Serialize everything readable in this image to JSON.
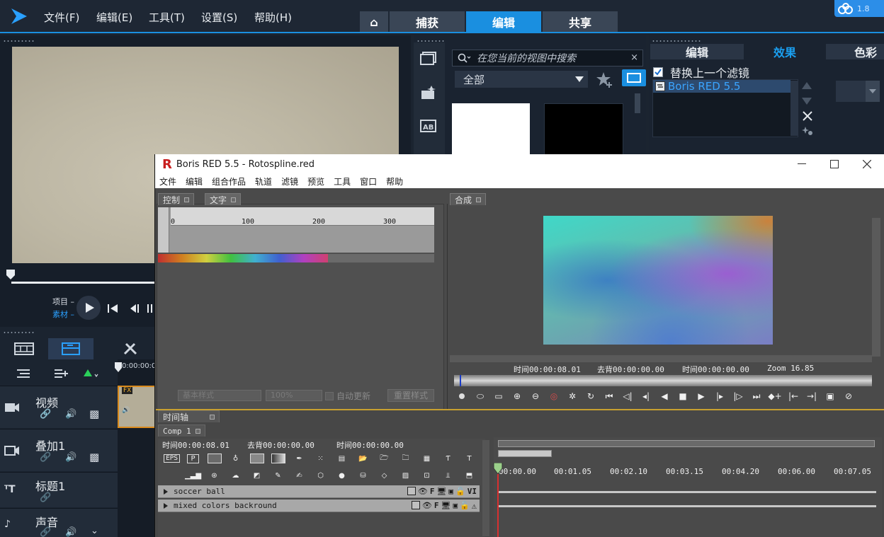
{
  "app_menu": [
    "文件(F)",
    "编辑(E)",
    "工具(T)",
    "设置(S)",
    "帮助(H)"
  ],
  "mode_tabs": {
    "home": "⌂",
    "capture": "捕获",
    "edit": "编辑",
    "share": "共享"
  },
  "cloud_badge": "1.8",
  "preview": {
    "project_label": "项目",
    "clip_label": "素材"
  },
  "library": {
    "search_placeholder": "在您当前的视图中搜索",
    "filter_value": "全部"
  },
  "effects": {
    "tabs": [
      "编辑",
      "效果",
      "色彩"
    ],
    "replace_filter_label": "替换上一个滤镜",
    "filter_item": "Boris RED 5.5"
  },
  "tracks": [
    {
      "name": "视频"
    },
    {
      "name": "叠加1"
    },
    {
      "name": "标题1"
    },
    {
      "name": "声音"
    }
  ],
  "timeline_ruler_start": "0:00:00:0",
  "clip_badge": "FX",
  "red": {
    "title": "Boris RED 5.5 - Rotospline.red",
    "menu": [
      "文件",
      "编辑",
      "组合作品",
      "轨道",
      "滤镜",
      "预览",
      "工具",
      "窗口",
      "帮助"
    ],
    "tabs_left": [
      "控制",
      "文字"
    ],
    "tab_comp": "合成",
    "ruler_labels": [
      "0",
      "100",
      "200",
      "300"
    ],
    "style_field": "基本样式",
    "percent_field": "100%",
    "auto_update_label": "自动更新",
    "reset_style_label": "重置样式",
    "comp_status": {
      "time": "时间00:00:08.01",
      "out": "去背00:00:00.00",
      "time2": "时间00:00:00.00",
      "zoom": "Zoom  16.85"
    },
    "timeline_tab": "时间轴",
    "comp_tab": "Comp 1",
    "tl_status": {
      "time": "时间00:00:08.01",
      "out": "去背00:00:00.00",
      "time2": "时间00:00:00.00"
    },
    "tool_eps": "EPS",
    "tool_p": "P",
    "layer_flags": "VI",
    "layers": [
      "soccer ball",
      "mixed colors backround"
    ],
    "tl_ruler": [
      "00:00.00",
      "00:01.05",
      "00:02.10",
      "00:03.15",
      "00:04.20",
      "00:06.00",
      "00:07.05"
    ]
  },
  "colors": {
    "accent": "#1a8fe0",
    "selection": "#2d4a6e",
    "clip_border": "#d98a1c"
  }
}
